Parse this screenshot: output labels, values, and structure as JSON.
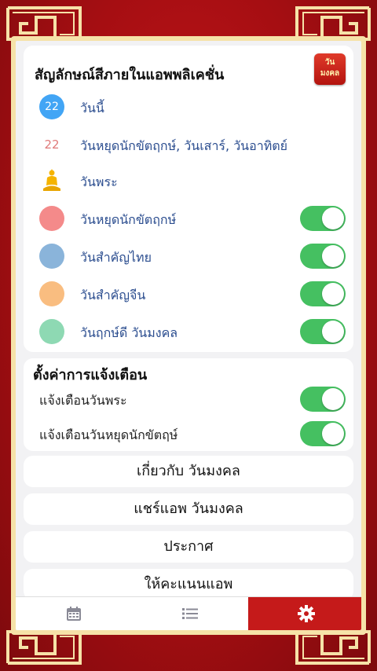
{
  "legend": {
    "title": "สัญลักษณ์สีภายในแอพพลิเคชั่น",
    "app_logo_text": [
      "วัน",
      "มงคล"
    ],
    "items": [
      {
        "icon": "today-badge",
        "number": "22",
        "label": "วันนี้",
        "color": "#42a5f5",
        "toggle": null
      },
      {
        "icon": "holiday-number",
        "number": "22",
        "label": "วันหยุดนักขัตฤกษ์, วันเสาร์, วันอาทิตย์",
        "color": "#e07a7a",
        "toggle": null
      },
      {
        "icon": "buddha-icon",
        "number": "",
        "label": "วันพระ",
        "color": "#f5b400",
        "toggle": null
      },
      {
        "icon": "color-dot",
        "number": "",
        "label": "วันหยุดนักขัตฤกษ์",
        "color": "#f48a8a",
        "toggle": true
      },
      {
        "icon": "color-dot",
        "number": "",
        "label": "วันสำคัญไทย",
        "color": "#8ab4da",
        "toggle": true
      },
      {
        "icon": "color-dot",
        "number": "",
        "label": "วันสำคัญจีน",
        "color": "#f9bd80",
        "toggle": true
      },
      {
        "icon": "color-dot",
        "number": "",
        "label": "วันฤกษ์ดี วันมงคล",
        "color": "#8ed9b3",
        "toggle": true
      }
    ]
  },
  "notifications": {
    "title": "ตั้งค่าการแจ้งเตือน",
    "items": [
      {
        "label": "แจ้งเตือนวันพระ",
        "toggle": true
      },
      {
        "label": "แจ้งเตือนวันหยุดนักขัตฤษ์",
        "toggle": true
      }
    ]
  },
  "menu": [
    {
      "label": "เกี่ยวกับ วันมงคล"
    },
    {
      "label": "แชร์แอพ วันมงคล"
    },
    {
      "label": "ประกาศ"
    },
    {
      "label": "ให้คะแนนแอพ"
    }
  ],
  "tabs": [
    {
      "icon": "calendar-icon",
      "active": false
    },
    {
      "icon": "list-icon",
      "active": false
    },
    {
      "icon": "settings-icon",
      "active": true
    }
  ],
  "colors": {
    "accent": "#c51a1a",
    "toggle_on": "#45c061",
    "label_blue": "#2b4d8f",
    "frame_gold": "#f6e2a8",
    "background_red": "#b3121a"
  }
}
